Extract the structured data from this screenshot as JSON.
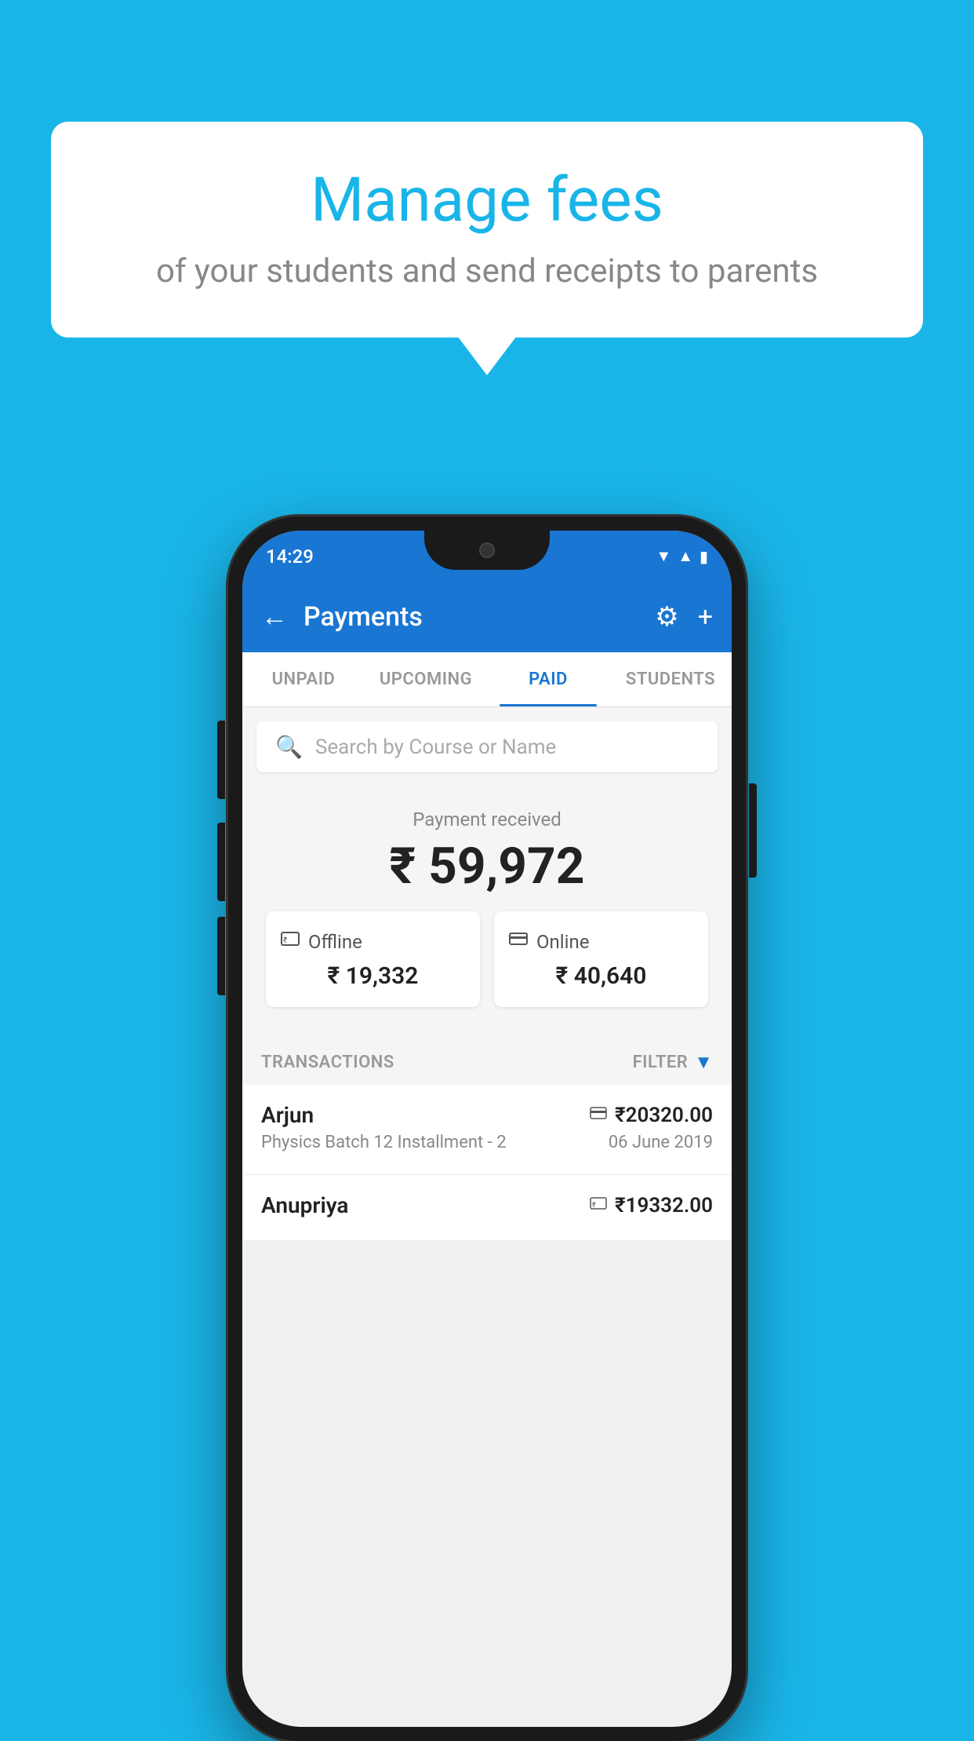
{
  "background_color": "#1ab5e8",
  "speech_bubble": {
    "title": "Manage fees",
    "subtitle": "of your students and send receipts to parents"
  },
  "phone": {
    "status_bar": {
      "time": "14:29",
      "icons": [
        "wifi",
        "signal",
        "battery"
      ]
    },
    "app_bar": {
      "title": "Payments",
      "back_label": "←",
      "settings_label": "⚙",
      "add_label": "+"
    },
    "tabs": [
      {
        "id": "unpaid",
        "label": "UNPAID",
        "active": false
      },
      {
        "id": "upcoming",
        "label": "UPCOMING",
        "active": false
      },
      {
        "id": "paid",
        "label": "PAID",
        "active": true
      },
      {
        "id": "students",
        "label": "STUDENTS",
        "active": false
      }
    ],
    "search": {
      "placeholder": "Search by Course or Name"
    },
    "payment_summary": {
      "label": "Payment received",
      "amount": "₹ 59,972",
      "offline": {
        "label": "Offline",
        "amount": "₹ 19,332"
      },
      "online": {
        "label": "Online",
        "amount": "₹ 40,640"
      }
    },
    "transactions": {
      "label": "TRANSACTIONS",
      "filter_label": "FILTER",
      "items": [
        {
          "name": "Arjun",
          "detail": "Physics Batch 12 Installment - 2",
          "amount": "₹20320.00",
          "date": "06 June 2019",
          "type": "online"
        },
        {
          "name": "Anupriya",
          "detail": "",
          "amount": "₹19332.00",
          "date": "",
          "type": "offline"
        }
      ]
    }
  }
}
